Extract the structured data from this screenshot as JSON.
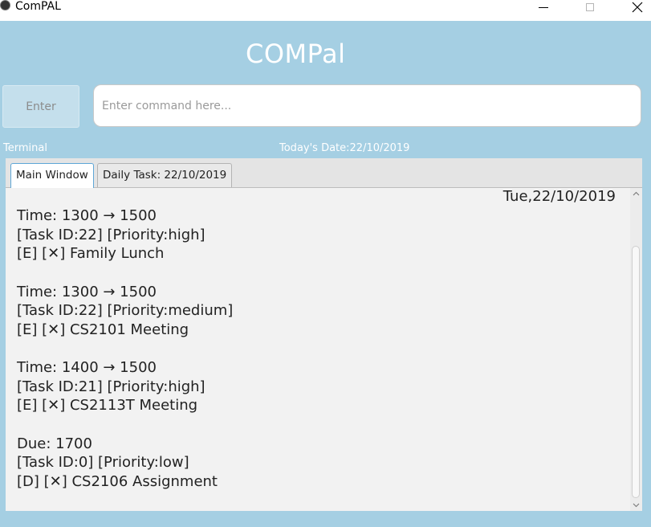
{
  "window": {
    "title": "ComPAL"
  },
  "header": {
    "app_name": "COMPal"
  },
  "command": {
    "enter_label": "Enter",
    "placeholder": "Enter command here...",
    "value": ""
  },
  "status": {
    "terminal_label": "Terminal",
    "today_date": "Today's Date:22/10/2019"
  },
  "tabs": [
    {
      "label": "Main Window",
      "active": true
    },
    {
      "label": "Daily Task: 22/10/2019",
      "active": false
    }
  ],
  "main": {
    "day_date": "Tue,22/10/2019",
    "tasks": [
      {
        "time": "Time: 1300 → 1500",
        "meta": "[Task ID:22] [Priority:high]",
        "desc": "[E] [✕] Family Lunch"
      },
      {
        "time": "Time: 1300 → 1500",
        "meta": "[Task ID:22] [Priority:medium]",
        "desc": "[E] [✕] CS2101 Meeting"
      },
      {
        "time": "Time: 1400 → 1500",
        "meta": "[Task ID:21] [Priority:high]",
        "desc": "[E] [✕] CS2113T Meeting"
      },
      {
        "time": "Due: 1700",
        "meta": "[Task ID:0] [Priority:low]",
        "desc": "[D] [✕] CS2106 Assignment"
      }
    ]
  },
  "colors": {
    "background": "#a5cfe3",
    "tab_accent": "#5ea6d6"
  },
  "icons": [
    "app-icon",
    "minimize-icon",
    "maximize-icon",
    "close-icon",
    "scroll-up-icon",
    "scroll-down-icon"
  ]
}
